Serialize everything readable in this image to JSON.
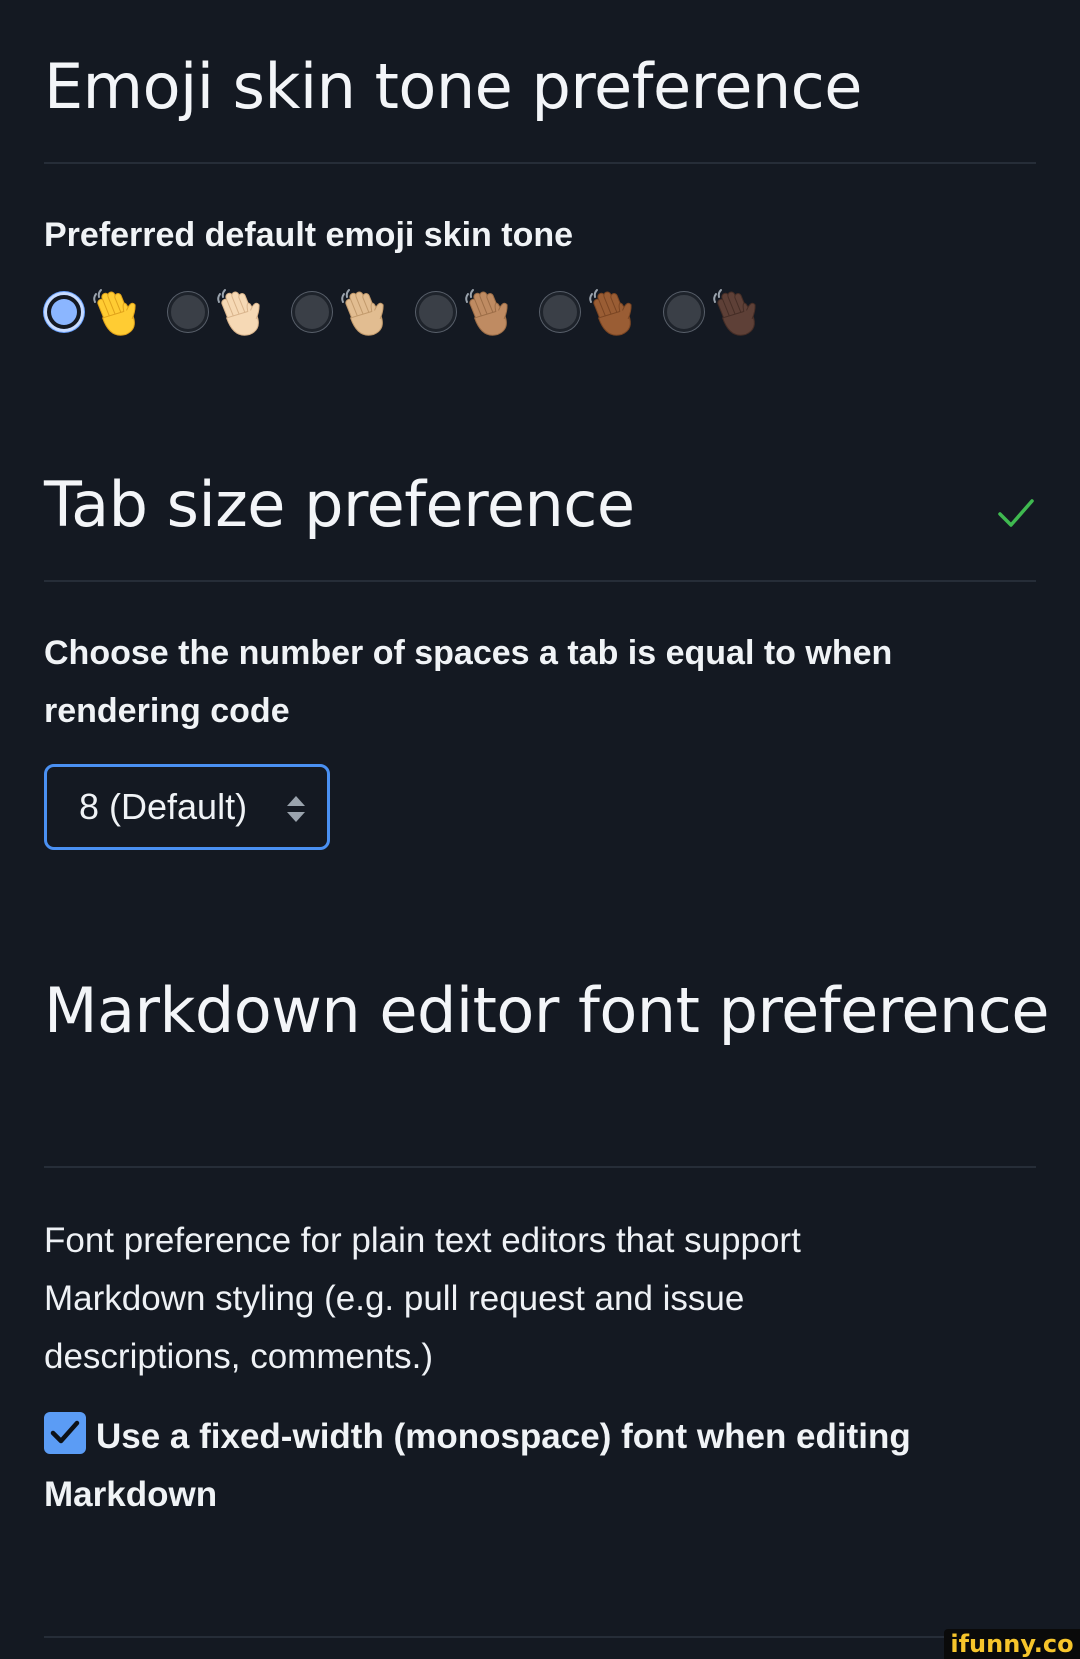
{
  "emoji_section": {
    "title": "Emoji skin tone preference",
    "label": "Preferred default emoji skin tone",
    "options": [
      {
        "tone": "default",
        "color": "#ffcc33",
        "shade": "#e0a21a",
        "selected": true
      },
      {
        "tone": "light",
        "color": "#f6d9b5",
        "shade": "#d9b48c",
        "selected": false
      },
      {
        "tone": "medium-light",
        "color": "#e2bd91",
        "shade": "#c29a6c",
        "selected": false
      },
      {
        "tone": "medium",
        "color": "#bf8b62",
        "shade": "#9c6d47",
        "selected": false
      },
      {
        "tone": "medium-dark",
        "color": "#9a5d34",
        "shade": "#7a4523",
        "selected": false
      },
      {
        "tone": "dark",
        "color": "#5e4037",
        "shade": "#452d26",
        "selected": false
      }
    ]
  },
  "tab_section": {
    "title": "Tab size preference",
    "saved_icon": "check-icon",
    "label": "Choose the number of spaces a tab is equal to when rendering code",
    "select_value": "8 (Default)"
  },
  "markdown_section": {
    "title": "Markdown editor font preference",
    "description": "Font preference for plain text editors that support Markdown styling (e.g. pull request and issue descriptions, comments.)",
    "checkbox_label": "Use a fixed-width (monospace) font when editing Markdown",
    "checkbox_checked": true
  },
  "watermark": "ifunny.co",
  "colors": {
    "background": "#141922",
    "accent": "#4a90f2",
    "success": "#3fb950"
  }
}
